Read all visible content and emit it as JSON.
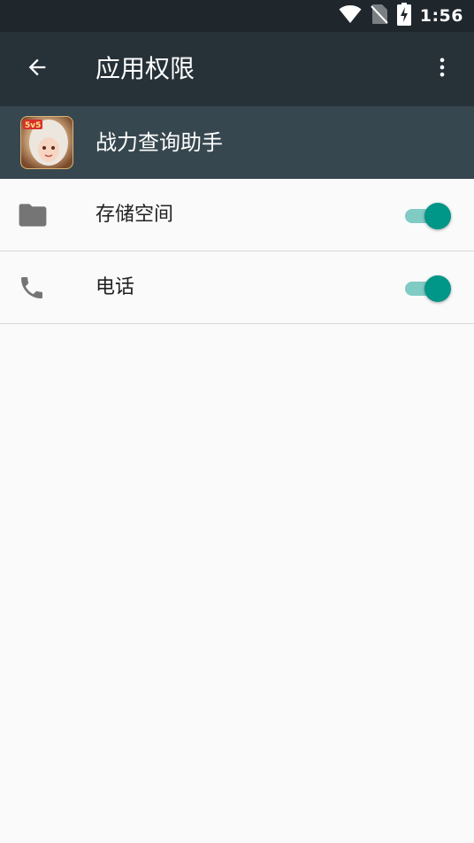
{
  "status_bar": {
    "time": "1:56",
    "icons": [
      "wifi-icon",
      "no-sim-icon",
      "battery-charging-icon"
    ]
  },
  "app_bar": {
    "title": "应用权限",
    "back_icon": "arrow-back-icon",
    "overflow_icon": "more-vert-icon"
  },
  "app_header": {
    "app_name": "战力查询助手",
    "app_icon": "app-icon"
  },
  "permissions": [
    {
      "label": "存储空间",
      "icon": "folder-icon",
      "enabled": true
    },
    {
      "label": "电话",
      "icon": "phone-icon",
      "enabled": true
    }
  ],
  "colors": {
    "status_bar": "#1f272d",
    "app_bar": "#263238",
    "app_header": "#37474f",
    "background": "#fafafa",
    "toggle_on_thumb": "#009688",
    "toggle_on_track": "#80cbc4",
    "icon_gray": "#757575"
  }
}
